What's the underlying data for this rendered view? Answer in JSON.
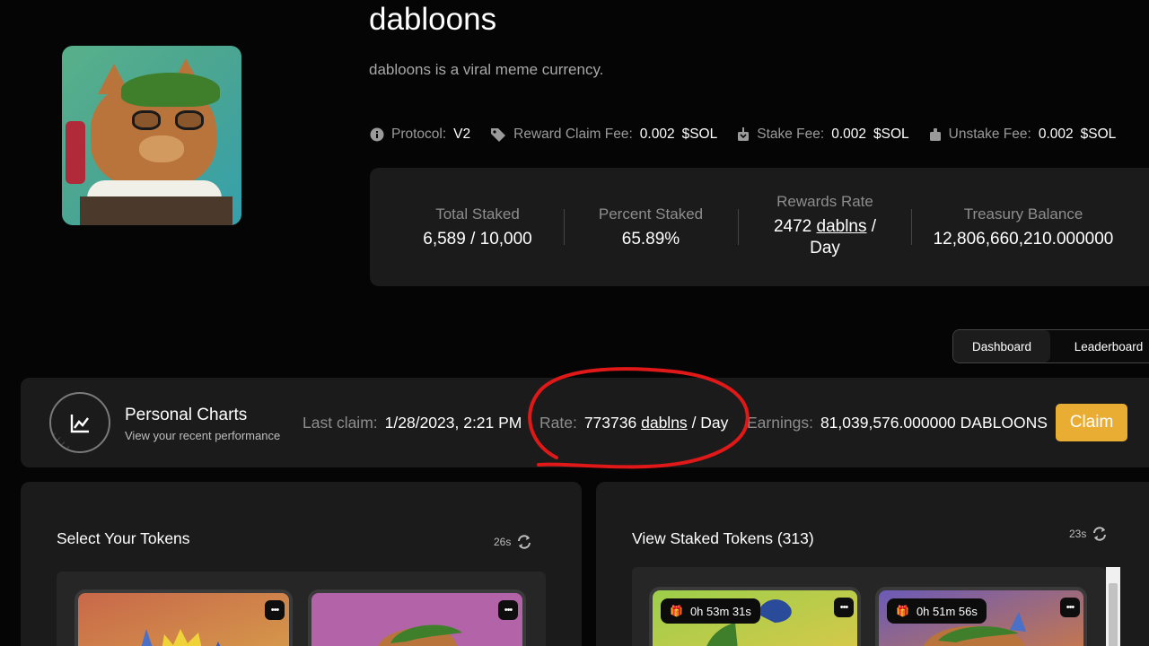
{
  "header": {
    "title": "dabloons",
    "description": "dabloons is a viral meme currency.",
    "avatar_icon": "pixel-cat-avatar"
  },
  "meta": {
    "protocol_label": "Protocol:",
    "protocol_value": "V2",
    "reward_claim_fee_label": "Reward Claim Fee:",
    "reward_claim_fee_value": "0.002",
    "reward_claim_fee_unit": "$SOL",
    "stake_fee_label": "Stake Fee:",
    "stake_fee_value": "0.002",
    "stake_fee_unit": "$SOL",
    "unstake_fee_label": "Unstake Fee:",
    "unstake_fee_value": "0.002",
    "unstake_fee_unit": "$SOL"
  },
  "stats": {
    "total_staked_label": "Total Staked",
    "total_staked_value": "6,589 / 10,000",
    "percent_staked_label": "Percent Staked",
    "percent_staked_value": "65.89%",
    "rewards_rate_label": "Rewards Rate",
    "rewards_rate_amount": "2472",
    "rewards_rate_token": "dablns",
    "rewards_rate_sep": "/",
    "rewards_rate_period": "Day",
    "treasury_label": "Treasury Balance",
    "treasury_value": "12,806,660,210.000000"
  },
  "tabs": {
    "dashboard": "Dashboard",
    "leaderboard": "Leaderboard"
  },
  "personal": {
    "title": "Personal Charts",
    "subtitle": "View your recent performance",
    "last_claim_label": "Last claim:",
    "last_claim_value": "1/28/2023, 2:21 PM",
    "rate_label": "Rate:",
    "rate_amount": "773736",
    "rate_token": "dablns",
    "rate_period": "/ Day",
    "earnings_label": "Earnings:",
    "earnings_value": "81,039,576.000000 DABLOONS",
    "claim_button": "Claim"
  },
  "select_tokens": {
    "title": "Select Your Tokens",
    "refresh_time": "26s"
  },
  "staked_tokens": {
    "title": "View Staked Tokens (313)",
    "refresh_time": "23s",
    "timers": [
      "0h 53m 31s",
      "0h 51m 56s"
    ]
  },
  "card_menu_glyph": "•••",
  "gift_glyph": "🎁",
  "colors": {
    "accent": "#e9ad34",
    "panel": "#1b1b1b",
    "annotation": "#e01818"
  }
}
